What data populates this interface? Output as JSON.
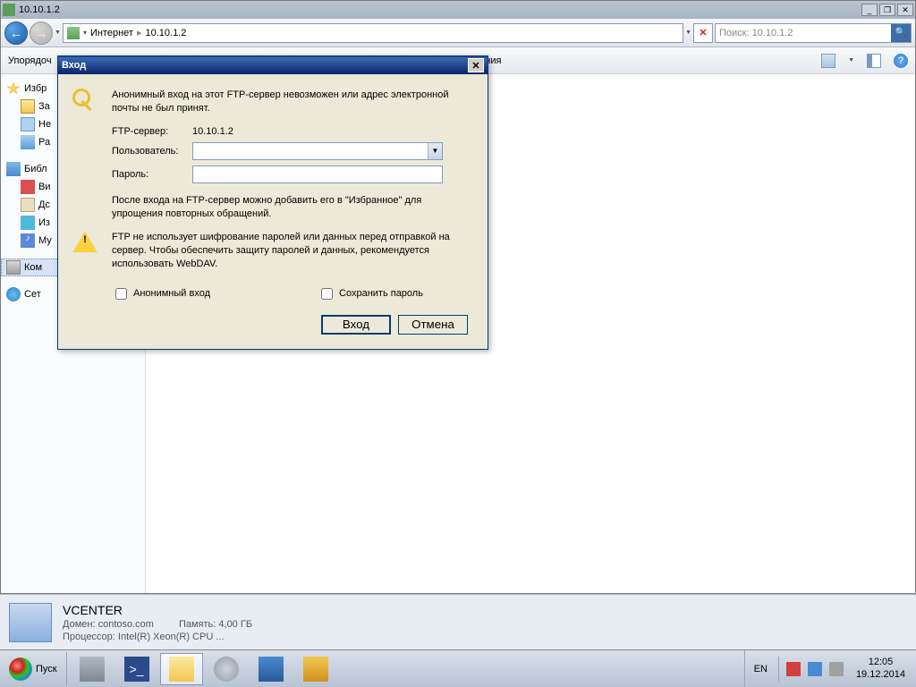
{
  "titlebar": {
    "title": "10.10.1.2"
  },
  "nav": {
    "crumb1": "Интернет",
    "crumb2": "10.10.1.2",
    "search_placeholder": "Поиск: 10.10.1.2"
  },
  "toolbar": {
    "organize": "Упорядоч",
    "open_cpl": "Открыть панель управления"
  },
  "sidebar": {
    "fav": "Избр",
    "dl": "За",
    "recent": "Не",
    "desk": "Ра",
    "lib": "Библ",
    "vid": "Ви",
    "doc": "Дс",
    "img": "Из",
    "mus": "Му",
    "comp": "Ком",
    "net": "Сет"
  },
  "dialog": {
    "title": "Вход",
    "msg": "Анонимный вход на этот FTP-сервер невозможен или адрес электронной почты не был принят.",
    "server_lbl": "FTP-сервер:",
    "server_val": "10.10.1.2",
    "user_lbl": "Пользователь:",
    "pass_lbl": "Пароль:",
    "note1": "После входа на FTP-сервер можно добавить его в \"Избранное\" для упрощения повторных обращений.",
    "note2": "FTP не использует шифрование паролей или данных перед отправкой на сервер. Чтобы обеспечить защиту паролей и данных, рекомендуется использовать WebDAV.",
    "anon": "Анонимный вход",
    "save": "Сохранить пароль",
    "login": "Вход",
    "cancel": "Отмена"
  },
  "status": {
    "host": "VCENTER",
    "domain_lbl": "Домен:",
    "domain": "contoso.com",
    "mem_lbl": "Память:",
    "mem": "4,00 ГБ",
    "cpu_lbl": "Процессор:",
    "cpu": "Intel(R) Xeon(R) CPU     ..."
  },
  "taskbar": {
    "start": "Пуск",
    "lang": "EN",
    "time": "12:05",
    "date": "19.12.2014"
  }
}
